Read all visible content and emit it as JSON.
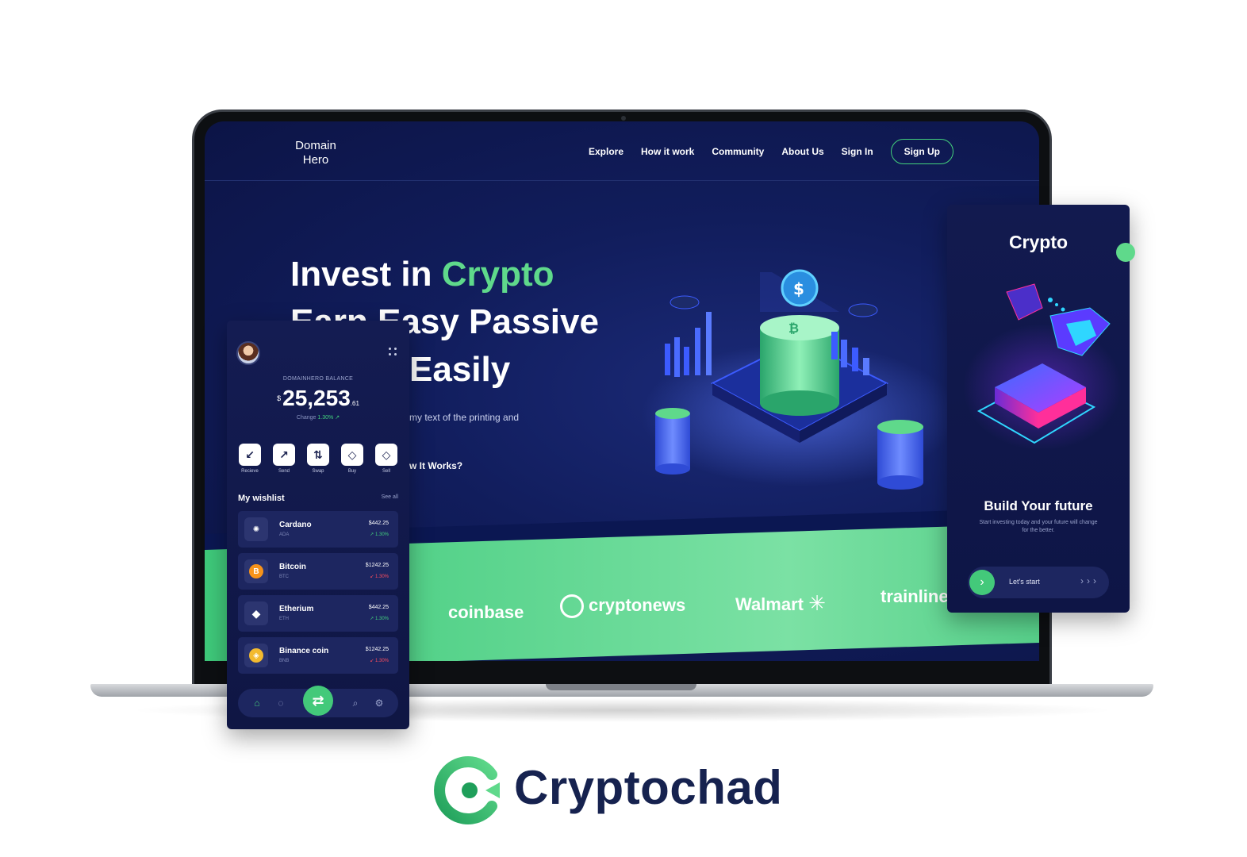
{
  "site": {
    "brand": [
      "Domain",
      "Hero"
    ],
    "nav": [
      "Explore",
      "How it work",
      "Community",
      "About Us",
      "Sign In"
    ],
    "signup_label": "Sign Up",
    "hero": {
      "line1_prefix": "Invest in ",
      "line1_accent": "Crypto",
      "line2": "Earn Easy Passive",
      "line3": "Easily",
      "desc_fragment": "my text of the printing and",
      "link_fragment": "w It Works?"
    },
    "partners": [
      "coinbase",
      "cryptonews",
      "Walmart",
      "trainline"
    ]
  },
  "phone": {
    "balance_label": "DOMAINHERO BALANCE",
    "currency": "$",
    "balance_main": "25,253",
    "balance_decimal": ".61",
    "change_label": "Change",
    "change_value": "1.30%",
    "actions": [
      "Recieve",
      "Send",
      "Swap",
      "Buy",
      "Sell"
    ],
    "wishlist_title": "My wishlist",
    "see_all": "See all",
    "coins": [
      {
        "name": "Cardano",
        "symbol": "ADA",
        "price": "$442.25",
        "change": "↗ 1.30%",
        "trend": "up",
        "color": "#2c3570"
      },
      {
        "name": "Bitcoin",
        "symbol": "BTC",
        "price": "$1242.25",
        "change": "↙ 1.30%",
        "trend": "down",
        "color": "#f7931a"
      },
      {
        "name": "Etherium",
        "symbol": "ETH",
        "price": "$442.25",
        "change": "↗ 1.30%",
        "trend": "up",
        "color": "#2c3570"
      },
      {
        "name": "Binance coin",
        "symbol": "BNB",
        "price": "$1242.25",
        "change": "↙ 1.30%",
        "trend": "down",
        "color": "#f3ba2f"
      }
    ]
  },
  "card": {
    "title": "Crypto",
    "heading": "Build Your future",
    "text": "Start investing today and your future will change for the better.",
    "cta": "Let's start"
  },
  "logo": {
    "word": "Cryptochad"
  },
  "colors": {
    "accent": "#43c97a",
    "navy": "#0f1644",
    "down": "#ff4d5e"
  }
}
